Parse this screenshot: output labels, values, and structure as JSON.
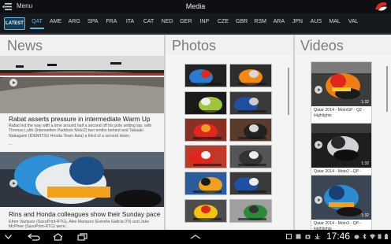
{
  "topbar": {
    "menu_label": "Menu",
    "title": "Media"
  },
  "tabs": {
    "latest": "LATEST",
    "rounds": [
      "QAT",
      "AME",
      "ARG",
      "SPA",
      "FRA",
      "ITA",
      "CAT",
      "NED",
      "GER",
      "INP",
      "CZE",
      "GBR",
      "RSM",
      "ARA",
      "JPN",
      "AUS",
      "MAL",
      "VAL"
    ],
    "active": "QAT"
  },
  "sections": {
    "news": "News",
    "photos": "Photos",
    "videos": "Videos"
  },
  "news": [
    {
      "title": "Rabat asserts pressure in intermediate Warm Up",
      "body": "Rabat led the way with a time around half a second off his pole setting lap, with Thomas Luthi (Interwetten Paddock Moto2) two tenths behind and Takaaki Nakagami (IDEMITSU Honda Team Asia) a third of a second down.",
      "more": "..."
    },
    {
      "title": "Rins and Honda colleagues show their Sunday pace",
      "body": "Efren Vazquez (SaxoPrint-RTG), Alex Marquez (Estrella Galicia 0'0) and Jake McPhee (SaxoPrint-RTG) were..."
    }
  ],
  "videos": [
    {
      "title": "Qatar 2014 - MotoGP - Q2 - Highlights",
      "duration": "1:32"
    },
    {
      "title": "Qatar 2014 - Moto2 - QP - Highlights",
      "duration": "1:32"
    },
    {
      "title": "Qatar 2014 - Moto3 - QP - Highlights",
      "duration": "1:32"
    }
  ],
  "statusbar": {
    "time": "17:46"
  },
  "colors": {
    "accent": "#5db8ee",
    "bar": "#16191d",
    "brand_red": "#e2261c"
  }
}
